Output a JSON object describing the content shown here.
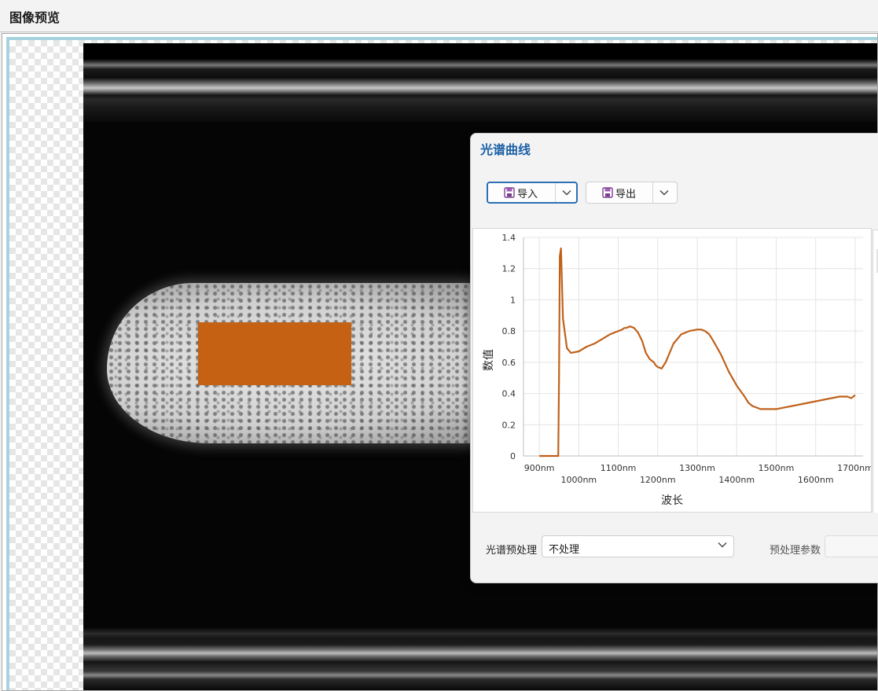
{
  "header": {
    "title": "图像预览"
  },
  "dialog": {
    "title": "光谱曲线",
    "import_label": "导入",
    "export_label": "导出",
    "preprocess_label": "光谱预处理",
    "preprocess_value": "不处理",
    "param_label": "预处理参数",
    "param_value": ""
  },
  "colors": {
    "roi": "#c56112",
    "curve": "#c0611a",
    "title_blue": "#1f63a8"
  },
  "icons": {
    "import": "save-icon",
    "export": "save-icon",
    "dropdown": "chevron-down-icon"
  },
  "chart_data": {
    "type": "line",
    "xlabel": "波长",
    "ylabel": "数值",
    "xlim": [
      860,
      1720
    ],
    "ylim": [
      0,
      1.4
    ],
    "grid": true,
    "x_ticks": [
      900,
      1000,
      1100,
      1200,
      1300,
      1400,
      1500,
      1600,
      1700
    ],
    "x_tick_labels": [
      "900nm",
      "1000nm",
      "1100nm",
      "1200nm",
      "1300nm",
      "1400nm",
      "1500nm",
      "1600nm",
      "1700nm"
    ],
    "y_ticks": [
      0,
      0.2,
      0.4,
      0.6,
      0.8,
      1,
      1.2,
      1.4
    ],
    "y_tick_labels": [
      "0",
      "0.2",
      "0.4",
      "0.6",
      "0.8",
      "1",
      "1.2",
      "1.4"
    ],
    "series": [
      {
        "x": [
          900,
          910,
          920,
          930,
          940,
          944,
          948,
          950,
          952,
          955,
          960,
          970,
          980,
          1000,
          1020,
          1040,
          1060,
          1080,
          1100,
          1110,
          1115,
          1120,
          1130,
          1140,
          1150,
          1160,
          1170,
          1180,
          1190,
          1195,
          1200,
          1210,
          1220,
          1240,
          1260,
          1280,
          1300,
          1310,
          1320,
          1330,
          1340,
          1360,
          1380,
          1400,
          1420,
          1430,
          1440,
          1450,
          1460,
          1480,
          1500,
          1520,
          1540,
          1560,
          1580,
          1600,
          1620,
          1640,
          1660,
          1680,
          1690,
          1700
        ],
        "values": [
          0,
          0,
          0,
          0,
          0,
          0,
          0,
          0.5,
          1.28,
          1.33,
          0.88,
          0.69,
          0.66,
          0.67,
          0.7,
          0.72,
          0.75,
          0.78,
          0.8,
          0.81,
          0.82,
          0.82,
          0.83,
          0.82,
          0.79,
          0.74,
          0.66,
          0.62,
          0.6,
          0.58,
          0.57,
          0.56,
          0.6,
          0.72,
          0.78,
          0.8,
          0.81,
          0.81,
          0.8,
          0.78,
          0.74,
          0.65,
          0.54,
          0.45,
          0.38,
          0.34,
          0.32,
          0.31,
          0.3,
          0.3,
          0.3,
          0.31,
          0.32,
          0.33,
          0.34,
          0.35,
          0.36,
          0.37,
          0.38,
          0.38,
          0.37,
          0.39
        ]
      }
    ]
  }
}
